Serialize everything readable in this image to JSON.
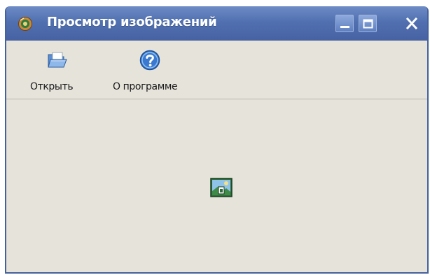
{
  "window": {
    "title": "Просмотр изображений",
    "icon": "app-viewer-icon",
    "controls": [
      "minimize-icon",
      "maximize-icon",
      "close-icon"
    ]
  },
  "toolbar": {
    "items": [
      {
        "label": "Открыть",
        "icon": "folder-open-icon"
      },
      {
        "label": "О программе",
        "icon": "help-icon"
      }
    ]
  },
  "content": {
    "placeholder_icon": "image-placeholder-icon"
  },
  "colors": {
    "titlebar": "#5170b0",
    "window_bg": "#e6e3da",
    "border": "#44619c",
    "help_blue": "#2f6fc9"
  }
}
